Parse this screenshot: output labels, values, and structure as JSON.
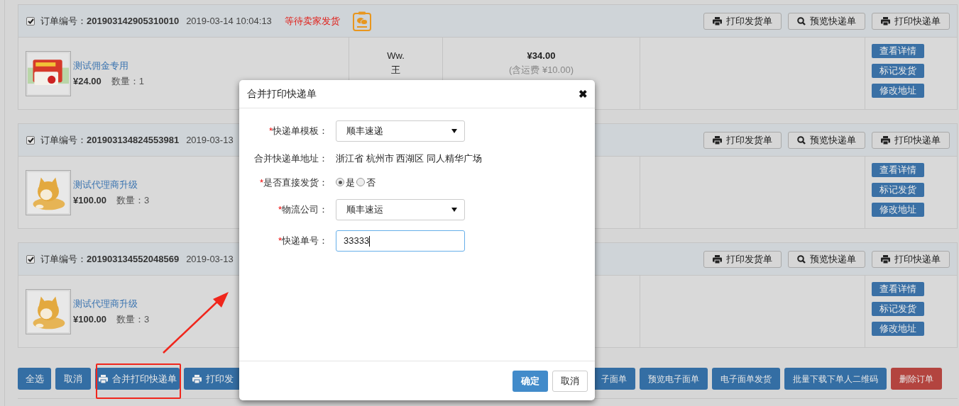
{
  "orders": [
    {
      "checked": true,
      "order_label": "订单编号：",
      "order_no": "201903142905310010",
      "time": "2019-03-14 10:04:13",
      "status": "等待卖家发货",
      "mini_program": true,
      "header_buttons": [
        {
          "label": "打印发货单",
          "kind": "print"
        },
        {
          "label": "预览快递单",
          "kind": "preview"
        },
        {
          "label": "打印快递单",
          "kind": "print"
        }
      ],
      "product": {
        "name": "测试佣金专用",
        "price": "¥24.00",
        "qty": "数量：1"
      },
      "buyer": [
        "Ww.",
        "王"
      ],
      "total": {
        "amount": "¥34.00",
        "note": "(含运费 ¥10.00)"
      },
      "actions": [
        "查看详情",
        "标记发货",
        "修改地址"
      ]
    },
    {
      "checked": true,
      "order_label": "订单编号：",
      "order_no": "201903134824553981",
      "time": "2019-03-13",
      "mini_program": false,
      "header_buttons": [
        {
          "label": "打印发货单",
          "kind": "print"
        },
        {
          "label": "预览快递单",
          "kind": "preview"
        },
        {
          "label": "打印快递单",
          "kind": "print"
        }
      ],
      "product": {
        "name": "测试代理商升级",
        "price": "¥100.00",
        "qty": "数量：3"
      },
      "actions": [
        "查看详情",
        "标记发货",
        "修改地址"
      ]
    },
    {
      "checked": true,
      "order_label": "订单编号：",
      "order_no": "201903134552048569",
      "time": "2019-03-13",
      "mini_program": false,
      "header_buttons": [
        {
          "label": "打印发货单",
          "kind": "print"
        },
        {
          "label": "预览快递单",
          "kind": "preview"
        },
        {
          "label": "打印快递单",
          "kind": "print"
        }
      ],
      "product": {
        "name": "测试代理商升级",
        "price": "¥100.00",
        "qty": "数量：3"
      },
      "actions": [
        "查看详情",
        "标记发货",
        "修改地址"
      ]
    }
  ],
  "bottom_buttons_left": [
    {
      "label": "全选",
      "kind": "primary",
      "print_icon": false,
      "highlighted": false
    },
    {
      "label": "取消",
      "kind": "primary",
      "print_icon": false,
      "highlighted": false
    },
    {
      "label": "合并打印快递单",
      "kind": "primary",
      "print_icon": true,
      "highlighted": true
    },
    {
      "label": "打印发",
      "kind": "primary",
      "print_icon": true,
      "highlighted": false
    }
  ],
  "bottom_buttons_right": [
    {
      "label": "子面单",
      "kind": "primary"
    },
    {
      "label": "预览电子面单",
      "kind": "primary"
    },
    {
      "label": "电子面单发货",
      "kind": "primary"
    },
    {
      "label": "批量下载下单人二维码",
      "kind": "primary"
    },
    {
      "label": "删除订单",
      "kind": "danger"
    }
  ],
  "dialog": {
    "title": "合并打印快递单",
    "close": "✖",
    "fields": [
      {
        "kind": "select",
        "required_mark": "*",
        "label": "快递单模板：",
        "value": "顺丰速递"
      },
      {
        "kind": "text",
        "label": "合并快递单地址：",
        "value": "浙江省 杭州市 西湖区 同人精华广场"
      },
      {
        "kind": "radio",
        "required_mark": "*",
        "label": "是否直接发货：",
        "options": [
          {
            "label": "是",
            "selected": true
          },
          {
            "label": "否",
            "selected": false
          }
        ]
      },
      {
        "kind": "select",
        "required_mark": "*",
        "label": "物流公司：",
        "value": "顺丰速运"
      },
      {
        "kind": "input",
        "required_mark": "*",
        "label": "快递单号：",
        "value": "33333",
        "focused": true
      }
    ],
    "buttons": [
      {
        "label": "确定",
        "kind": "primary"
      },
      {
        "label": "取消",
        "kind": "default"
      }
    ]
  },
  "annotation_arrow": true
}
